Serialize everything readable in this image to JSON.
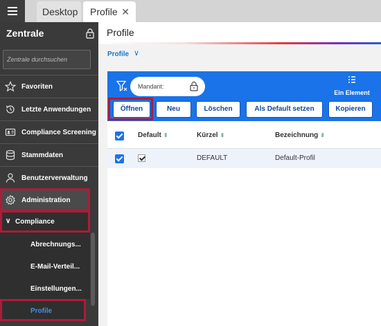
{
  "tabs": [
    {
      "label": "Desktop"
    },
    {
      "label": "Profile"
    }
  ],
  "sidebar": {
    "title": "Zentrale",
    "search_placeholder": "Zentrale durchsuchen",
    "items": [
      {
        "label": "Favoriten",
        "icon": "star-icon"
      },
      {
        "label": "Letzte Anwendungen",
        "icon": "history-icon"
      },
      {
        "label": "Compliance Screening",
        "icon": "id-card-icon"
      },
      {
        "label": "Stammdaten",
        "icon": "database-icon"
      },
      {
        "label": "Benutzerverwaltung",
        "icon": "user-icon"
      },
      {
        "label": "Administration",
        "icon": "gear-icon"
      }
    ],
    "section": {
      "label": "Compliance"
    },
    "subitems": [
      {
        "label": "Abrechnungs..."
      },
      {
        "label": "E-Mail-Verteil..."
      },
      {
        "label": "Einstellungen..."
      },
      {
        "label": "Profile"
      }
    ]
  },
  "main": {
    "title": "Profile",
    "breadcrumb": "Profile",
    "mandant_label": "Mandant:",
    "ein_element": "Ein Element",
    "buttons": {
      "open": "Öffnen",
      "new": "Neu",
      "delete": "Löschen",
      "default": "Als Default setzen",
      "copy": "Kopieren"
    },
    "columns": [
      "Default",
      "Kürzel",
      "Bezeichnung"
    ],
    "rows": [
      {
        "default": true,
        "kuerzel": "DEFAULT",
        "bezeichnung": "Default-Profil"
      }
    ]
  },
  "colors": {
    "accent": "#1a73e8",
    "sidebar": "#3a3a3a",
    "highlight": "#b01a3a"
  }
}
